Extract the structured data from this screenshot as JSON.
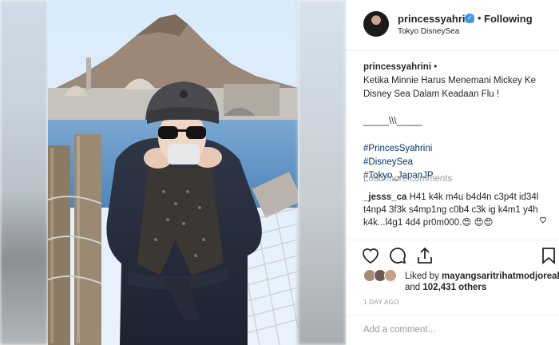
{
  "post": {
    "username": "princessyahrini",
    "verified_icon": "verified-badge-icon",
    "separator": "•",
    "follow_status": "Following",
    "location": "Tokyo DisneySea"
  },
  "caption": {
    "username": "princessyahrini",
    "separator": "•",
    "line1": "Ketika Minnie Harus Menemani Mickey Ke",
    "line2": "Disney Sea Dalam Keadaan Flu !",
    "divider": "_____\\\\\\_____",
    "hashtags": [
      "#PrincesSyahrini",
      "#DisneySea",
      "#Tokyo_JapanJP"
    ]
  },
  "comments": {
    "load_more": "Load more comments",
    "items": [
      {
        "username": "_jesss_ca",
        "text": "H41 k4k m4u b4d4n c3p4t id34l t4np4 3f3k s4mp1ng c0b4 c3k ig k4m1 y4h k4k...l4g1 4d4 pr0m000.😍 😍😍"
      }
    ]
  },
  "actions": {
    "icons": [
      "heart-icon",
      "comment-icon",
      "share-icon",
      "bookmark-icon"
    ]
  },
  "likes": {
    "prefix": "Liked by",
    "top_user": "mayangsaritrihatmodjoreal",
    "and": "and",
    "count": "102,431 others"
  },
  "timestamp": "1 DAY AGO",
  "add_comment_placeholder": "Add a comment...",
  "colors": {
    "link": "#003569",
    "muted": "#999999",
    "verified": "#3897f0",
    "border": "#efefef"
  }
}
